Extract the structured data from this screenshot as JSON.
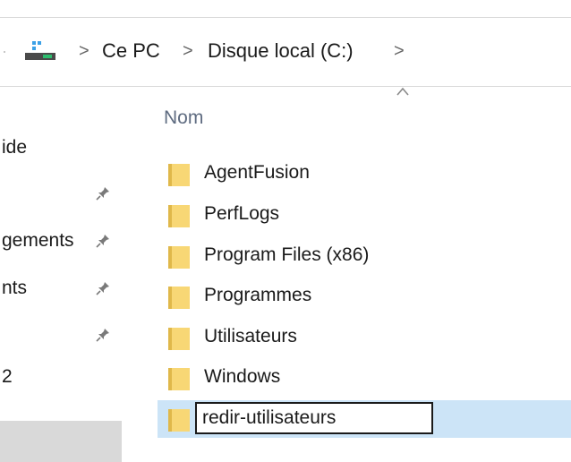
{
  "breadcrumb": {
    "items": [
      "Ce PC",
      "Disque local (C:)"
    ],
    "separator": ">"
  },
  "column_header": {
    "name_label": "Nom"
  },
  "nav_pane": {
    "items": [
      {
        "label": "ide",
        "pinned": false
      },
      {
        "label": "",
        "pinned": true
      },
      {
        "label": "gements",
        "pinned": true
      },
      {
        "label": "nts",
        "pinned": true
      },
      {
        "label": "",
        "pinned": true
      },
      {
        "label": "2",
        "pinned": false
      }
    ]
  },
  "files": [
    {
      "name": "AgentFusion",
      "type": "folder"
    },
    {
      "name": "PerfLogs",
      "type": "folder"
    },
    {
      "name": "Program Files (x86)",
      "type": "folder"
    },
    {
      "name": "Programmes",
      "type": "folder"
    },
    {
      "name": "Utilisateurs",
      "type": "folder"
    },
    {
      "name": "Windows",
      "type": "folder"
    }
  ],
  "rename": {
    "value": "redir-utilisateurs",
    "type": "folder"
  },
  "colors": {
    "folder_yellow": "#f8d775",
    "folder_dark": "#e0b84a",
    "selection_blue": "#cce4f7",
    "header_text": "#5e6b80"
  },
  "icons": {
    "pc": "computer-icon",
    "pin": "pin-icon",
    "folder": "folder-icon",
    "sort": "sort-ascending-icon"
  }
}
